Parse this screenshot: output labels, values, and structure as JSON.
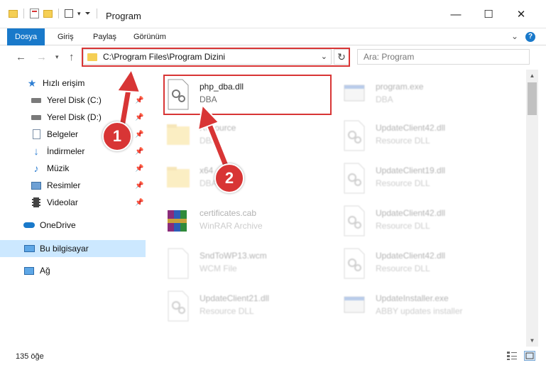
{
  "window": {
    "title": "Program",
    "minimize_glyph": "—",
    "maximize_glyph": "☐",
    "close_glyph": "✕"
  },
  "ribbon": {
    "tabs": [
      {
        "label": "Dosya",
        "active": true
      },
      {
        "label": "Giriş",
        "active": false
      },
      {
        "label": "Paylaş",
        "active": false
      },
      {
        "label": "Görünüm",
        "active": false
      }
    ],
    "help": "?"
  },
  "navbar": {
    "address": "C:\\Program Files\\Program Dizini",
    "search_placeholder": "Ara: Program"
  },
  "sidebar": {
    "items": [
      {
        "label": "Hızlı erişim",
        "icon": "star-icon",
        "pinned": false
      },
      {
        "label": "Yerel Disk (C:)",
        "icon": "drive-icon",
        "pinned": true
      },
      {
        "label": "Yerel Disk (D:)",
        "icon": "drive-icon",
        "pinned": true
      },
      {
        "label": "Belgeler",
        "icon": "documents-icon",
        "pinned": true
      },
      {
        "label": "İndirmeler",
        "icon": "download-icon",
        "pinned": true
      },
      {
        "label": "Müzik",
        "icon": "music-icon",
        "pinned": true
      },
      {
        "label": "Resimler",
        "icon": "pictures-icon",
        "pinned": true
      },
      {
        "label": "Videolar",
        "icon": "videos-icon",
        "pinned": true
      },
      {
        "label": "OneDrive",
        "icon": "cloud-icon",
        "pinned": false
      },
      {
        "label": "Bu bilgisayar",
        "icon": "computer-icon",
        "pinned": false,
        "selected": true
      },
      {
        "label": "Ağ",
        "icon": "network-icon",
        "pinned": false
      }
    ]
  },
  "files": [
    {
      "name": "php_dba.dll",
      "desc": "DBA",
      "icon": "dll-gear-icon",
      "highlighted": true
    },
    {
      "name": "Resource",
      "desc": "DBA",
      "icon": "folder-icon"
    },
    {
      "name": "x64",
      "desc": "DBA",
      "icon": "folder-icon"
    },
    {
      "name": "certificates.cab",
      "desc": "WinRAR Archive",
      "icon": "winrar-icon"
    },
    {
      "name": "SndToWP13.wcm",
      "desc": "WCM File",
      "icon": "blank-file-icon"
    },
    {
      "name": "UpdateClient21.dll",
      "desc": "Resource DLL",
      "icon": "dll-gear-icon"
    },
    {
      "name": "program.exe",
      "desc": "DBA",
      "icon": "exe-icon"
    },
    {
      "name": "UpdateClient42.dll",
      "desc": "Resource DLL",
      "icon": "dll-gear-icon"
    },
    {
      "name": "UpdateClient19.dll",
      "desc": "Resource DLL",
      "icon": "dll-gear-icon"
    },
    {
      "name": "UpdateClient42.dll",
      "desc": "Resource DLL",
      "icon": "dll-gear-icon"
    },
    {
      "name": "UpdateClient42.dll",
      "desc": "Resource DLL",
      "icon": "dll-gear-icon"
    },
    {
      "name": "UpdateInstaller.exe",
      "desc": "ABBY updates installer",
      "icon": "exe-icon"
    }
  ],
  "statusbar": {
    "count": "135 öğe"
  },
  "callouts": [
    {
      "number": "1"
    },
    {
      "number": "2"
    }
  ],
  "colors": {
    "accent": "#1979ca",
    "highlight": "#d83535",
    "selected": "#cce8ff",
    "folder": "#f5cf55"
  }
}
